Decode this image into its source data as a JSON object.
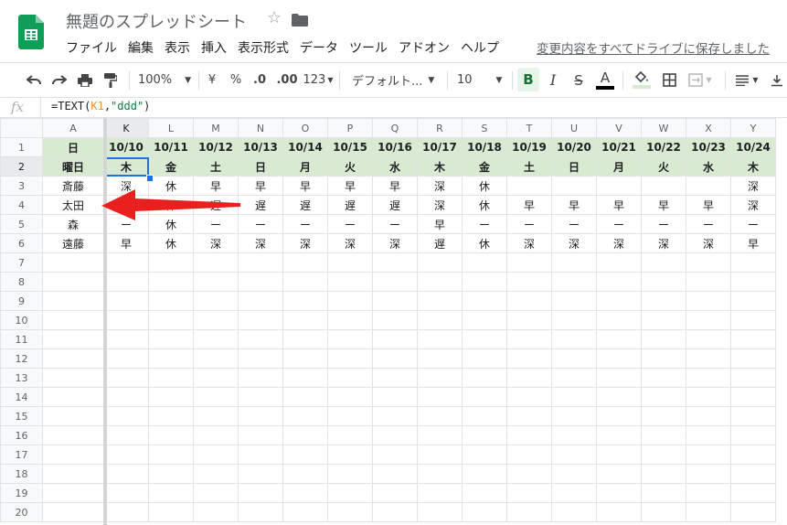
{
  "header": {
    "title": "無題のスプレッドシート",
    "save_status": "変更内容をすべてドライブに保存しました"
  },
  "menu": [
    "ファイル",
    "編集",
    "表示",
    "挿入",
    "表示形式",
    "データ",
    "ツール",
    "アドオン",
    "ヘルプ"
  ],
  "toolbar": {
    "zoom": "100%",
    "currency": "¥",
    "percent": "%",
    "dec_decrease": ".0",
    "dec_increase": ".00",
    "more_formats": "123",
    "font": "デフォルト...",
    "font_size": "10",
    "bold": "B",
    "italic": "I",
    "strike": "S",
    "text_color": "A"
  },
  "formula": {
    "fx": "fx",
    "prefix": "=TEXT(",
    "ref": "K1",
    "comma": ",",
    "arg": "\"ddd\"",
    "suffix": ")"
  },
  "grid": {
    "columns": [
      "A",
      "K",
      "L",
      "M",
      "N",
      "O",
      "P",
      "Q",
      "R",
      "S",
      "T",
      "U",
      "V",
      "W",
      "X",
      "Y"
    ],
    "row_numbers": [
      "1",
      "2",
      "3",
      "4",
      "5",
      "6",
      "7",
      "8",
      "9",
      "10",
      "11",
      "12",
      "13",
      "14",
      "15",
      "16",
      "17",
      "18",
      "19",
      "20"
    ],
    "rows": [
      [
        "日",
        "10/10",
        "10/11",
        "10/12",
        "10/13",
        "10/14",
        "10/15",
        "10/16",
        "10/17",
        "10/18",
        "10/19",
        "10/20",
        "10/21",
        "10/22",
        "10/23",
        "10/24"
      ],
      [
        "曜日",
        "木",
        "金",
        "土",
        "日",
        "月",
        "火",
        "水",
        "木",
        "金",
        "土",
        "日",
        "月",
        "火",
        "水",
        "木"
      ],
      [
        "斎藤",
        "深",
        "休",
        "早",
        "早",
        "早",
        "早",
        "早",
        "深",
        "休",
        "",
        "",
        "",
        "",
        "",
        "深"
      ],
      [
        "太田",
        "早",
        "休",
        "遅",
        "遅",
        "遅",
        "遅",
        "遅",
        "深",
        "休",
        "早",
        "早",
        "早",
        "早",
        "早",
        "深"
      ],
      [
        "森",
        "ー",
        "休",
        "ー",
        "ー",
        "ー",
        "ー",
        "ー",
        "早",
        "ー",
        "ー",
        "ー",
        "ー",
        "ー",
        "ー",
        "ー"
      ],
      [
        "遠藤",
        "早",
        "休",
        "深",
        "深",
        "深",
        "深",
        "深",
        "遅",
        "休",
        "深",
        "深",
        "深",
        "深",
        "深",
        "早"
      ]
    ],
    "active_cell": "K2"
  },
  "colors": {
    "header_fill": "#d9ead3",
    "selection": "#1a73e8",
    "arrow": "#e8211f",
    "logo": "#0f9d58"
  }
}
